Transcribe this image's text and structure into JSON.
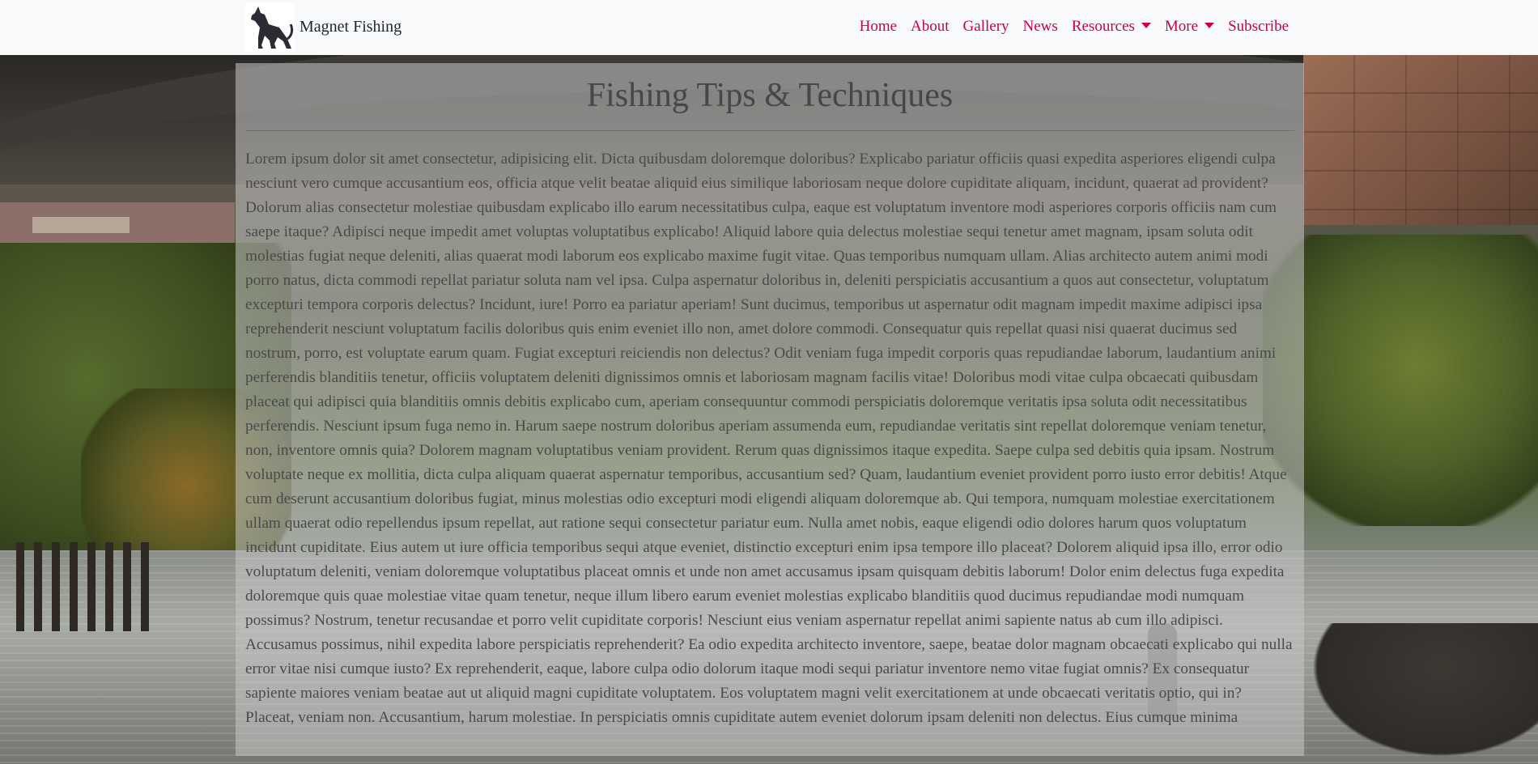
{
  "navbar": {
    "brand_name": "Magnet Fishing",
    "brand_logo_icon": "dog-logo-icon",
    "links": [
      {
        "label": "Home"
      },
      {
        "label": "About"
      },
      {
        "label": "Gallery"
      },
      {
        "label": "News"
      },
      {
        "label": "Resources",
        "dropdown": true
      },
      {
        "label": "More",
        "dropdown": true
      },
      {
        "label": "Subscribe"
      }
    ],
    "link_color": "#c8004f",
    "background": "#f8f9fa"
  },
  "main": {
    "title": "Fishing Tips & Techniques",
    "body": "Lorem ipsum dolor sit amet consectetur, adipisicing elit. Dicta quibusdam doloremque doloribus? Explicabo pariatur officiis quasi expedita asperiores eligendi culpa nesciunt vero cumque accusantium eos, officia atque velit beatae aliquid eius similique laboriosam neque dolore cupiditate aliquam, incidunt, quaerat ad provident? Dolorum alias consectetur molestiae quibusdam explicabo illo earum necessitatibus culpa, eaque est voluptatum inventore modi asperiores corporis officiis nam cum saepe itaque? Adipisci neque impedit amet voluptas voluptatibus explicabo! Aliquid labore quia delectus molestiae sequi tenetur amet magnam, ipsam soluta odit molestias fugiat neque deleniti, alias quaerat modi laborum eos explicabo maxime fugit vitae. Quas temporibus numquam ullam. Alias architecto autem animi modi porro natus, dicta commodi repellat pariatur soluta nam vel ipsa. Culpa aspernatur doloribus in, deleniti perspiciatis accusantium a quos aut consectetur, voluptatum excepturi tempora corporis delectus? Incidunt, iure! Porro ea pariatur aperiam! Sunt ducimus, temporibus ut aspernatur odit magnam impedit maxime adipisci ipsa reprehenderit nesciunt voluptatum facilis doloribus quis enim eveniet illo non, amet dolore commodi. Consequatur quis repellat quasi nisi quaerat ducimus sed nostrum, porro, est voluptate earum quam. Fugiat excepturi reiciendis non delectus? Odit veniam fuga impedit corporis quas repudiandae laborum, laudantium animi perferendis blanditiis tenetur, officiis voluptatem deleniti dignissimos omnis et laboriosam magnam facilis vitae! Doloribus modi vitae culpa obcaecati quibusdam placeat qui adipisci quia blanditiis omnis debitis explicabo cum, aperiam consequuntur commodi perspiciatis doloremque veritatis ipsa soluta odit necessitatibus perferendis. Nesciunt ipsum fuga nemo in. Harum saepe nostrum doloribus aperiam assumenda eum, repudiandae veritatis sint repellat doloremque veniam tenetur, non, inventore omnis quia? Dolorem magnam voluptatibus veniam provident. Rerum quas dignissimos itaque expedita. Saepe culpa sed debitis quia ipsam. Nostrum voluptate neque ex mollitia, dicta culpa aliquam quaerat aspernatur temporibus, accusantium sed? Quam, laudantium eveniet provident porro iusto error debitis! Atque cum deserunt accusantium doloribus fugiat, minus molestias odio excepturi modi eligendi aliquam doloremque ab. Qui tempora, numquam molestiae exercitationem ullam quaerat odio repellendus ipsum repellat, aut ratione sequi consectetur pariatur eum. Nulla amet nobis, eaque eligendi odio dolores harum quos voluptatum incidunt cupiditate. Eius autem ut iure officia temporibus sequi atque eveniet, distinctio excepturi enim ipsa tempore illo placeat? Dolorem aliquid ipsa illo, error odio voluptatum deleniti, veniam doloremque voluptatibus placeat omnis et unde non amet accusamus ipsam quisquam debitis laborum! Dolor enim delectus fuga expedita doloremque quis quae molestiae vitae quam tenetur, neque illum libero earum eveniet molestias explicabo blanditiis quod ducimus repudiandae modi numquam possimus? Nostrum, tenetur recusandae et porro velit cupiditate corporis! Nesciunt eius veniam aspernatur repellat animi sapiente natus ab cum illo adipisci. Accusamus possimus, nihil expedita labore perspiciatis reprehenderit? Ea odio expedita architecto inventore, saepe, beatae dolor magnam obcaecati explicabo qui nulla error vitae nisi cumque iusto? Ex reprehenderit, eaque, labore culpa odio dolorum itaque modi sequi pariatur inventore nemo vitae fugiat omnis? Ex consequatur sapiente maiores veniam beatae aut ut aliquid magni cupiditate voluptatem. Eos voluptatem magni velit exercitationem at unde obcaecati veritatis optio, qui in? Placeat, veniam non. Accusantium, harum molestiae. In perspiciatis omnis cupiditate autem eveniet dolorum ipsam deleniti non delectus. Eius cumque minima"
  }
}
